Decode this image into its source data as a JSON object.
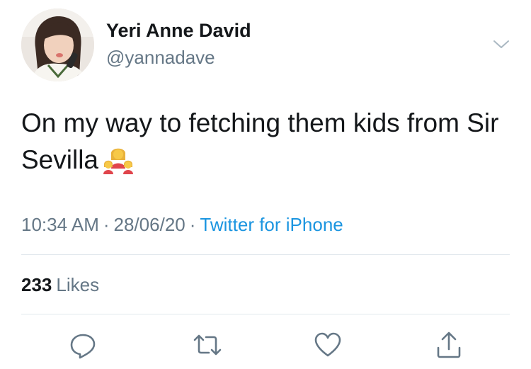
{
  "tweet": {
    "author": {
      "display_name": "Yeri Anne David",
      "handle": "@yannadave",
      "avatar_icon": "profile-photo"
    },
    "text": "On my way to fetching them kids from Sir Sevilla",
    "emoji_icon": "family-woman-girl-girl-emoji",
    "timestamp_time": "10:34 AM",
    "separator": "·",
    "timestamp_date": "28/06/20",
    "source": "Twitter for iPhone",
    "likes_count": "233",
    "likes_label": "Likes"
  },
  "actions": {
    "reply_icon": "reply-icon",
    "retweet_icon": "retweet-icon",
    "like_icon": "heart-icon",
    "share_icon": "share-icon",
    "more_icon": "chevron-down-icon"
  },
  "colors": {
    "primary_text": "#14171a",
    "secondary_text": "#657786",
    "link": "#1b95e0",
    "divider": "#e1e8ed",
    "icon": "#657786"
  }
}
